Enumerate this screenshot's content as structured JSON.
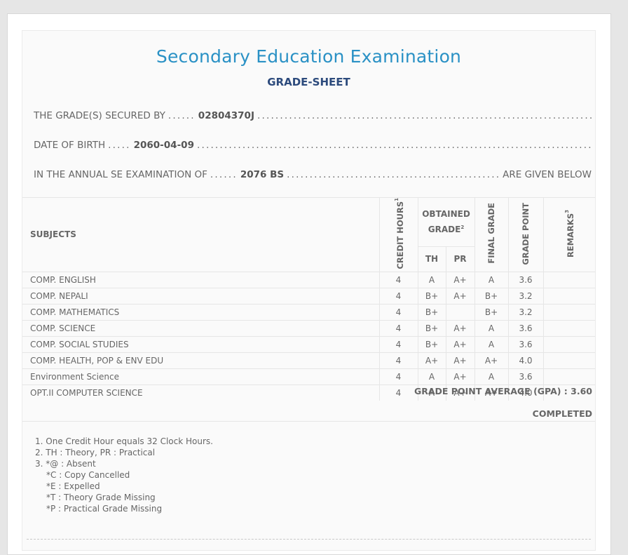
{
  "header": {
    "title": "Secondary Education Examination",
    "subtitle": "GRADE-SHEET"
  },
  "info": {
    "secured_by_label": "THE GRADE(S) SECURED BY",
    "secured_by_value": "02804370J",
    "dob_label": "DATE OF BIRTH",
    "dob_value": "2060-04-09",
    "exam_label": "IN THE ANNUAL SE EXAMINATION OF",
    "exam_value": "2076 BS",
    "exam_tail": "ARE GIVEN BELOW"
  },
  "table": {
    "headers": {
      "subjects": "SUBJECTS",
      "credit_hours": "CREDIT HOURS",
      "obtained_grade": "OBTAINED GRADE",
      "th": "TH",
      "pr": "PR",
      "final_grade": "FINAL GRADE",
      "grade_point": "GRADE POINT",
      "remarks": "REMARKS"
    },
    "rows": [
      {
        "subject": "COMP. ENGLISH",
        "credit": "4",
        "th": "A",
        "pr": "A+",
        "final": "A",
        "gp": "3.6",
        "remarks": ""
      },
      {
        "subject": "COMP. NEPALI",
        "credit": "4",
        "th": "B+",
        "pr": "A+",
        "final": "B+",
        "gp": "3.2",
        "remarks": ""
      },
      {
        "subject": "COMP. MATHEMATICS",
        "credit": "4",
        "th": "B+",
        "pr": "",
        "final": "B+",
        "gp": "3.2",
        "remarks": ""
      },
      {
        "subject": "COMP. SCIENCE",
        "credit": "4",
        "th": "B+",
        "pr": "A+",
        "final": "A",
        "gp": "3.6",
        "remarks": ""
      },
      {
        "subject": "COMP. SOCIAL STUDIES",
        "credit": "4",
        "th": "B+",
        "pr": "A+",
        "final": "A",
        "gp": "3.6",
        "remarks": ""
      },
      {
        "subject": "COMP. HEALTH, POP & ENV EDU",
        "credit": "4",
        "th": "A+",
        "pr": "A+",
        "final": "A+",
        "gp": "4.0",
        "remarks": ""
      },
      {
        "subject": "Environment Science",
        "credit": "4",
        "th": "A",
        "pr": "A+",
        "final": "A",
        "gp": "3.6",
        "remarks": ""
      },
      {
        "subject": "OPT.II COMPUTER SCIENCE",
        "credit": "4",
        "th": "A",
        "pr": "A+",
        "final": "A+",
        "gp": "4.0",
        "remarks": ""
      }
    ]
  },
  "summary": {
    "gpa": "GRADE POINT AVERAGE (GPA) : 3.60",
    "status": "COMPLETED"
  },
  "notes": {
    "n1": "1. One Credit Hour equals 32 Clock Hours.",
    "n2": "2. TH : Theory, PR : Practical",
    "n3": "3. *@ : Absent",
    "n3a": "*C : Copy Cancelled",
    "n3b": "*E : Expelled",
    "n3c": "*T : Theory Grade Missing",
    "n3d": "*P : Practical Grade Missing"
  }
}
